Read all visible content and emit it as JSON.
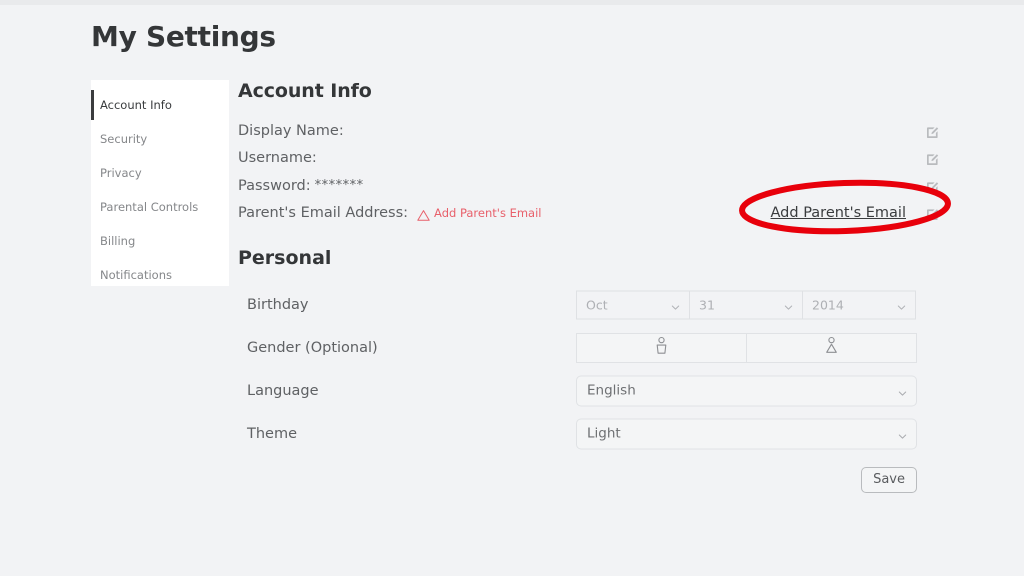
{
  "page": {
    "title": "My Settings",
    "background_color": "#f2f3f5"
  },
  "sidebar": {
    "items": [
      {
        "label": "Account Info",
        "active": true
      },
      {
        "label": "Security",
        "active": false
      },
      {
        "label": "Privacy",
        "active": false
      },
      {
        "label": "Parental Controls",
        "active": false
      },
      {
        "label": "Billing",
        "active": false
      },
      {
        "label": "Notifications",
        "active": false
      }
    ]
  },
  "account_info": {
    "heading": "Account Info",
    "rows": [
      {
        "label": "Display Name:",
        "value": "",
        "icon": "edit-icon"
      },
      {
        "label": "Username:",
        "value": "",
        "icon": "edit-icon"
      },
      {
        "label": "Password:",
        "value": "*******",
        "icon": "edit-icon"
      },
      {
        "label": "Parent's Email Address:",
        "value": "",
        "icon": "edit-icon"
      }
    ],
    "warning": {
      "icon": "warning-triangle-icon",
      "text": "Add Parent's Email",
      "color": "#e8606b"
    },
    "add_parent_link": "Add Parent's Email"
  },
  "personal": {
    "heading": "Personal",
    "birthday": {
      "label": "Birthday",
      "month": "Oct",
      "day": "31",
      "year": "2014"
    },
    "gender": {
      "label": "Gender (Optional)",
      "options": [
        {
          "icon": "male-figure-icon"
        },
        {
          "icon": "female-figure-icon"
        }
      ]
    },
    "language": {
      "label": "Language",
      "value": "English"
    },
    "theme": {
      "label": "Theme",
      "value": "Light"
    }
  },
  "actions": {
    "save_label": "Save"
  },
  "annotation": {
    "shape": "red-ellipse-highlight",
    "color": "#e8000b",
    "target": "Add Parent's Email"
  }
}
